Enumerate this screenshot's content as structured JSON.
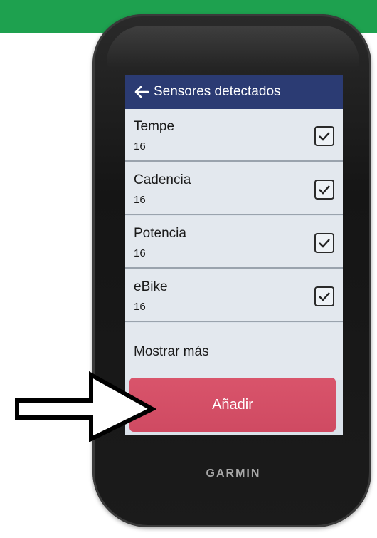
{
  "screen": {
    "header": {
      "title": "Sensores detectados",
      "back_icon": "back-arrow-icon"
    },
    "sensors": [
      {
        "name": "Tempe",
        "id": "16",
        "checked": true
      },
      {
        "name": "Cadencia",
        "id": "16",
        "checked": true
      },
      {
        "name": "Potencia",
        "id": "16",
        "checked": true
      },
      {
        "name": "eBike",
        "id": "16",
        "checked": true
      }
    ],
    "show_more_label": "Mostrar más",
    "add_button_label": "Añadir"
  },
  "device": {
    "brand": "GARMIN"
  },
  "colors": {
    "banner": "#1ea14f",
    "header": "#2b3b73",
    "add_button": "#d9546b",
    "screen_bg": "#e3e8ee"
  },
  "overlay": {
    "icon": "pointer-arrow-icon"
  }
}
